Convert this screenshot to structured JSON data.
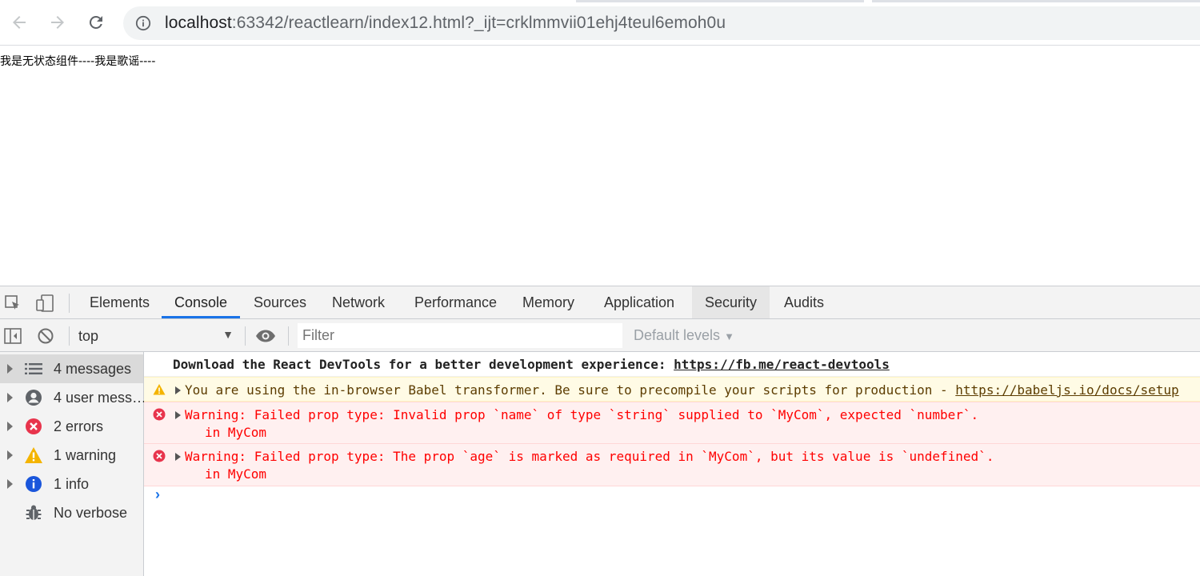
{
  "browser": {
    "url_host": "localhost",
    "url_rest": ":63342/reactlearn/index12.html?_ijt=crklmmvii01ehj4teul6emoh0u"
  },
  "page": {
    "text": "我是无状态组件----我是歌谣----"
  },
  "devtools": {
    "tabs": [
      "Elements",
      "Console",
      "Sources",
      "Network",
      "Performance",
      "Memory",
      "Application",
      "Security",
      "Audits"
    ],
    "active_tab": "Console",
    "toolbar": {
      "context": "top",
      "filter_placeholder": "Filter",
      "levels": "Default levels"
    },
    "sidebar": [
      {
        "label": "4 messages",
        "icon": "list-icon"
      },
      {
        "label": "4 user mess…",
        "icon": "user-icon"
      },
      {
        "label": "2 errors",
        "icon": "error-icon"
      },
      {
        "label": "1 warning",
        "icon": "warning-icon"
      },
      {
        "label": "1 info",
        "icon": "info-icon"
      },
      {
        "label": "No verbose",
        "icon": "bug-icon"
      }
    ],
    "messages": [
      {
        "level": "info",
        "text": "Download the React DevTools for a better development experience: ",
        "link": "https://fb.me/react-devtools"
      },
      {
        "level": "warning",
        "text": "You are using the in-browser Babel transformer. Be sure to precompile your scripts for production - ",
        "link": "https://babeljs.io/docs/setup"
      },
      {
        "level": "error",
        "text": "Warning: Failed prop type: Invalid prop `name` of type `string` supplied to `MyCom`, expected `number`.",
        "sub": "in MyCom"
      },
      {
        "level": "error",
        "text": "Warning: Failed prop type: The prop `age` is marked as required in `MyCom`, but its value is `undefined`.",
        "sub": "in MyCom"
      }
    ],
    "colors": {
      "accent": "#1a73e8",
      "error": "#ff0000",
      "warning_bg": "#fffbe5",
      "error_bg": "#fff0f0"
    }
  }
}
